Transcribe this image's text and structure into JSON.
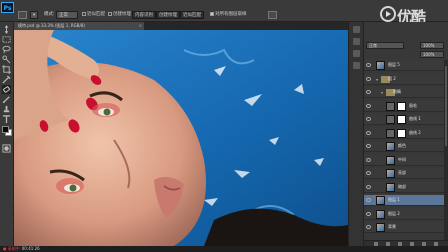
{
  "app": {
    "logo": "Ps"
  },
  "options_bar": {
    "mode_label": "正常",
    "opacity_label": "不透明度",
    "flow_label": "流量",
    "content_aware_label": "内容识别",
    "create_texture_label": "创建纹理",
    "proximity_label": "近似匹配",
    "sample_all_label": "对所有图层取样"
  },
  "document_tab": {
    "label": "模特.psd @ 33.3% (图层 1, RGB/8)",
    "close": "×"
  },
  "layers_panel": {
    "blend_mode": "正常",
    "opacity": "100%",
    "layers": [
      {
        "name": "图层 5",
        "kind": "pixel",
        "selected": false,
        "indent": 0,
        "mask": false
      },
      {
        "name": "组 2",
        "kind": "group",
        "selected": false,
        "indent": 0,
        "mask": false
      },
      {
        "name": "眼睛",
        "kind": "group",
        "selected": false,
        "indent": 1,
        "mask": false
      },
      {
        "name": "眉毛",
        "kind": "adjust",
        "selected": false,
        "indent": 2,
        "mask": true
      },
      {
        "name": "曲线 1",
        "kind": "adjust",
        "selected": false,
        "indent": 2,
        "mask": true
      },
      {
        "name": "曲线 2",
        "kind": "adjust",
        "selected": false,
        "indent": 2,
        "mask": true
      },
      {
        "name": "颜色",
        "kind": "pixel",
        "selected": false,
        "indent": 2,
        "mask": false
      },
      {
        "name": "中间",
        "kind": "pixel",
        "selected": false,
        "indent": 2,
        "mask": false
      },
      {
        "name": "亮部",
        "kind": "pixel",
        "selected": false,
        "indent": 2,
        "mask": false
      },
      {
        "name": "暗部",
        "kind": "pixel",
        "selected": false,
        "indent": 2,
        "mask": false
      },
      {
        "name": "图层 1",
        "kind": "pixel",
        "selected": true,
        "indent": 0,
        "mask": false
      },
      {
        "name": "图层 2",
        "kind": "pixel",
        "selected": false,
        "indent": 0,
        "mask": false
      },
      {
        "name": "背景",
        "kind": "pixel",
        "selected": false,
        "indent": 0,
        "mask": false
      }
    ]
  },
  "status": {
    "rec_label": "● 录制中",
    "time": "00:41:26"
  },
  "watermark": {
    "text": "优酷"
  },
  "colors": {
    "water": "#1c6fb5",
    "accent_selected": "#5a7699",
    "foreground": "#0b0b0b",
    "background": "#ffffff"
  }
}
